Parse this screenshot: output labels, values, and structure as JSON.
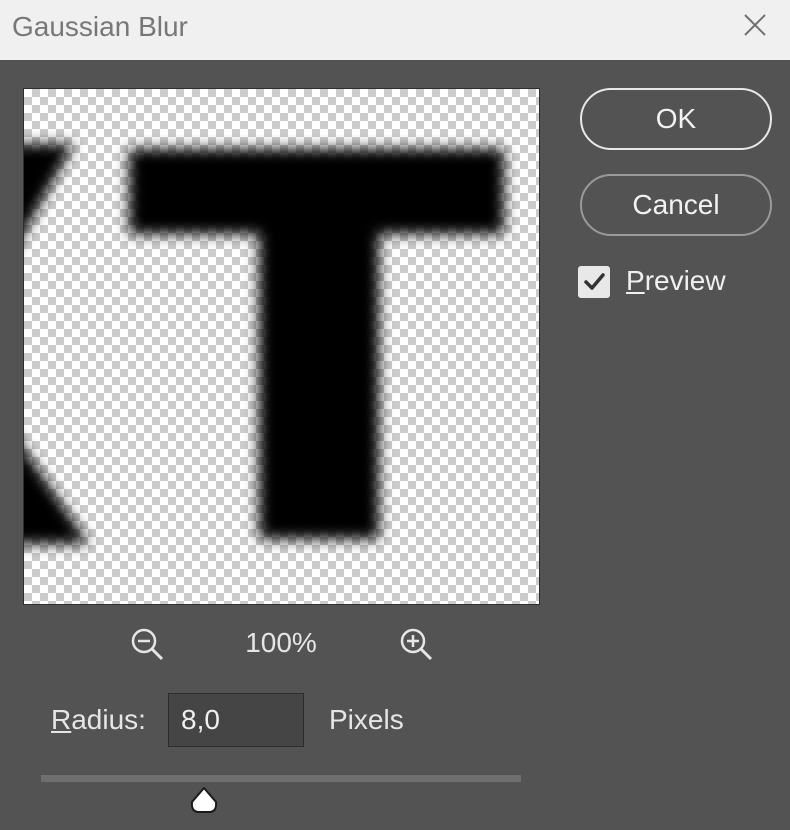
{
  "window": {
    "title": "Gaussian Blur",
    "close_icon": "close-icon"
  },
  "preview": {
    "description_icon": "checkerboard-preview",
    "zoom_out_icon": "zoom-out-icon",
    "zoom_in_icon": "zoom-in-icon",
    "zoom_level": "100%"
  },
  "radius": {
    "label_first": "R",
    "label_rest": "adius:",
    "value": "8,0",
    "unit": "Pixels",
    "slider_fraction": 0.34
  },
  "buttons": {
    "ok": "OK",
    "cancel": "Cancel"
  },
  "preview_toggle": {
    "checked": true,
    "label_first": "P",
    "label_rest": "review"
  },
  "colors": {
    "background": "#535353",
    "titlebar": "#f0f0f0",
    "text": "#e6e6e6"
  }
}
